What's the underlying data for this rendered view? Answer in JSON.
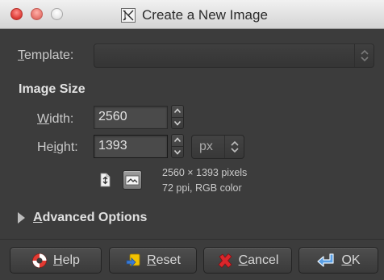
{
  "window": {
    "title": "Create a New Image"
  },
  "template": {
    "label_prefix": "",
    "label_mnemonic": "T",
    "label_rest": "emplate:",
    "value": ""
  },
  "image_size": {
    "heading": "Image Size",
    "width": {
      "label_mnemonic": "W",
      "label_rest": "idth:",
      "value": "2560"
    },
    "height": {
      "label_prefix": "He",
      "label_mnemonic": "i",
      "label_rest": "ght:",
      "value": "1393"
    },
    "unit": "px",
    "info_line_1": "2560 × 1393 pixels",
    "info_line_2": "72 ppi, RGB color"
  },
  "advanced": {
    "mnemonic": "A",
    "rest": "dvanced Options"
  },
  "buttons": {
    "help": {
      "mnemonic": "H",
      "rest": "elp"
    },
    "reset": {
      "mnemonic": "R",
      "rest": "eset"
    },
    "cancel": {
      "mnemonic": "C",
      "rest": "ancel"
    },
    "ok": {
      "mnemonic": "O",
      "rest": "K"
    }
  },
  "colors": {
    "background": "#3c3c3c",
    "titlebar": "#d4d4d4",
    "close_red": "#e0443e",
    "cancel_red": "#d9262b",
    "ok_blue": "#5aa0e6",
    "reset_yellow": "#f2c200"
  },
  "icons": {
    "title": "gimp-icon",
    "portrait": "portrait-orientation-icon",
    "landscape": "landscape-orientation-icon",
    "help": "lifebuoy-icon",
    "reset": "reset-icon",
    "cancel": "cancel-x-icon",
    "ok": "enter-arrow-icon"
  }
}
